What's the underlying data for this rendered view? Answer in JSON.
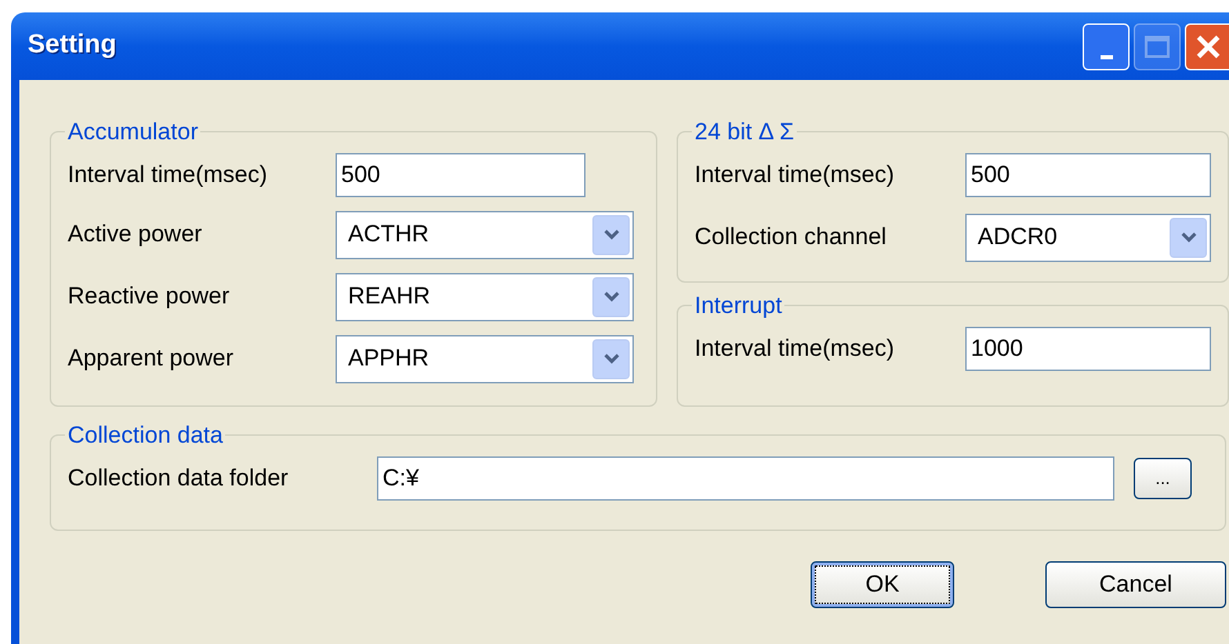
{
  "window": {
    "title": "Setting"
  },
  "groups": [
    {
      "title": "Accumulator",
      "rows": [
        {
          "kind": "text",
          "label": "Interval time(msec)",
          "value": "500"
        },
        {
          "kind": "combo",
          "label": "Active power",
          "value": "ACTHR"
        },
        {
          "kind": "combo",
          "label": "Reactive power",
          "value": "REAHR"
        },
        {
          "kind": "combo",
          "label": "Apparent power",
          "value": "APPHR"
        }
      ]
    },
    {
      "title": "24 bit Δ Σ",
      "rows": [
        {
          "kind": "text",
          "label": "Interval time(msec)",
          "value": "500"
        },
        {
          "kind": "combo",
          "label": "Collection channel",
          "value": "ADCR0"
        }
      ]
    },
    {
      "title": "Interrupt",
      "rows": [
        {
          "kind": "text",
          "label": "Interval time(msec)",
          "value": "1000"
        }
      ]
    },
    {
      "title": "Collection data",
      "rows": [
        {
          "kind": "folder",
          "label": "Collection data folder",
          "value": "C:¥",
          "button": "..."
        }
      ]
    }
  ],
  "buttons": [
    {
      "label": "OK",
      "default": true
    },
    {
      "label": "Cancel",
      "default": false
    }
  ]
}
